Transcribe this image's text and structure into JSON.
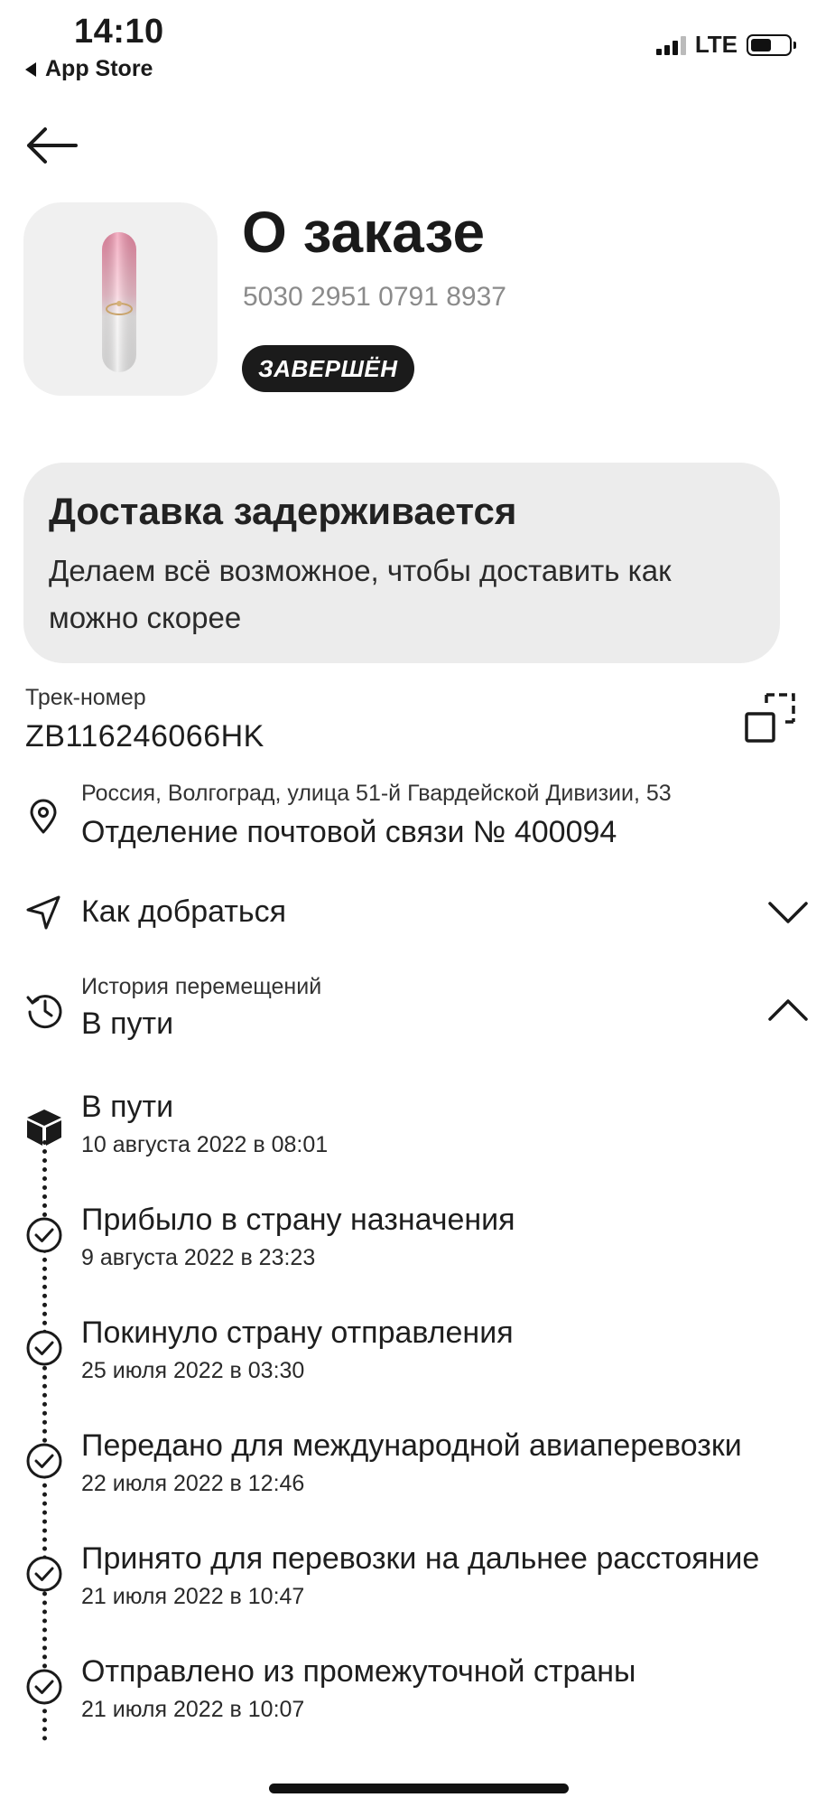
{
  "status_bar": {
    "time": "14:10",
    "back_app": "App Store",
    "network": "LTE"
  },
  "order": {
    "title": "О заказе",
    "number": "5030 2951 0791 8937",
    "status_badge": "ЗАВЕРШЁН"
  },
  "notice": {
    "title": "Доставка задерживается",
    "text": "Делаем всё возможное, чтобы доставить как можно скорее"
  },
  "tracking": {
    "label": "Трек-номер",
    "number": "ZB116246066HK"
  },
  "pickup": {
    "address": "Россия, Волгоград, улица 51-й Гвардейской Дивизии, 53",
    "office": "Отделение почтовой связи № 400094"
  },
  "directions": {
    "label": "Как добраться"
  },
  "history": {
    "label": "История перемещений",
    "current": "В пути",
    "events": [
      {
        "title": "В пути",
        "date": "10 августа 2022 в 08:01"
      },
      {
        "title": "Прибыло в страну назначения",
        "date": "9 августа 2022 в 23:23"
      },
      {
        "title": "Покинуло страну отправления",
        "date": "25 июля 2022 в 03:30"
      },
      {
        "title": "Передано для международной авиаперевозки",
        "date": "22 июля 2022 в 12:46"
      },
      {
        "title": "Принято для перевозки на дальнее расстояние",
        "date": "21 июля 2022 в 10:47"
      },
      {
        "title": "Отправлено из промежуточной страны",
        "date": "21 июля 2022 в 10:07"
      }
    ]
  }
}
